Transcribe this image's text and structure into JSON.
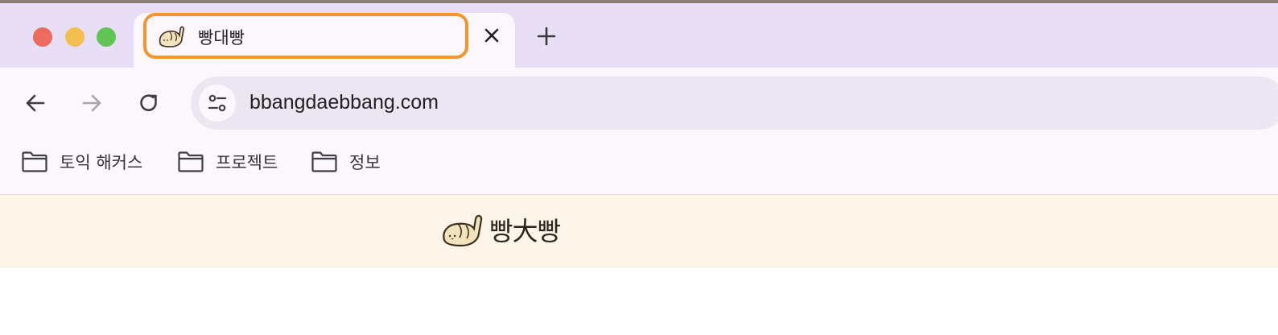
{
  "tab": {
    "title": "빵대빵",
    "favicon": "bread-cat-icon",
    "highlight_color": "#f0962d"
  },
  "toolbar": {
    "url": "bbangdaebbang.com"
  },
  "bookmarks": [
    {
      "label": "토익 해커스",
      "icon": "folder-icon"
    },
    {
      "label": "프로젝트",
      "icon": "folder-icon"
    },
    {
      "label": "정보",
      "icon": "folder-icon"
    }
  ],
  "site": {
    "logo_text": "빵大빵",
    "logo_icon": "bread-cat-icon"
  }
}
